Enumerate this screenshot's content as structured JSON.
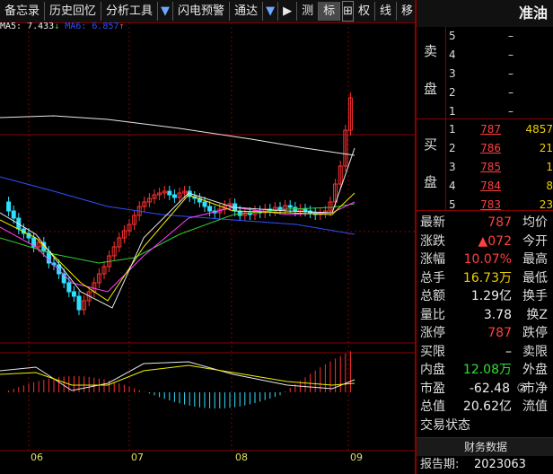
{
  "toolbar": {
    "items": [
      "备忘录",
      "历史回忆",
      "分析工具",
      "闪电预警",
      "通达",
      "测",
      "标",
      "权",
      "线",
      "移"
    ],
    "arrow": "▼",
    "play": "▶"
  },
  "ma": {
    "ma5": "MA5: 7.433",
    "ma5_arrow": "↓",
    "ma6": "MA6: 6.857",
    "ma6_arrow": "↑"
  },
  "stock": {
    "name": "准油"
  },
  "orderbook": {
    "sell_label_1": "卖",
    "sell_label_2": "盘",
    "buy_label_1": "买",
    "buy_label_2": "盘",
    "sell": [
      {
        "level": "5",
        "price": "",
        "vol": "–"
      },
      {
        "level": "4",
        "price": "",
        "vol": "–"
      },
      {
        "level": "3",
        "price": "",
        "vol": "–"
      },
      {
        "level": "2",
        "price": "",
        "vol": "–"
      },
      {
        "level": "1",
        "price": "",
        "vol": "–"
      }
    ],
    "buy": [
      {
        "level": "1",
        "price": "787",
        "vol": "4857"
      },
      {
        "level": "2",
        "price": "786",
        "vol": "21"
      },
      {
        "level": "3",
        "price": "785",
        "vol": "1"
      },
      {
        "level": "4",
        "price": "784",
        "vol": "8"
      },
      {
        "level": "5",
        "price": "783",
        "vol": "23"
      }
    ]
  },
  "stats": [
    {
      "k": "最新",
      "v": "787",
      "vc": "red",
      "k2": "均价"
    },
    {
      "k": "涨跌",
      "v": "▲072",
      "vc": "red",
      "k2": "今开"
    },
    {
      "k": "涨幅",
      "v": "10.07%",
      "vc": "red",
      "k2": "最高"
    },
    {
      "k": "总手",
      "v": "16.73万",
      "vc": "yellow",
      "k2": "最低"
    },
    {
      "k": "总额",
      "v": "1.29亿",
      "vc": "white",
      "k2": "换手"
    },
    {
      "k": "量比",
      "v": "3.78",
      "vc": "white",
      "k2": "换Z"
    },
    {
      "k": "涨停",
      "v": "787",
      "vc": "red",
      "k2": "跌停"
    },
    {
      "k": "买限",
      "v": "–",
      "vc": "white",
      "k2": "卖限"
    },
    {
      "k": "内盘",
      "v": "12.08万",
      "vc": "green",
      "k2": "外盘"
    },
    {
      "k": "市盈",
      "v": "-62.48",
      "vc": "white",
      "k2": "市净"
    },
    {
      "k": "总值",
      "v": "20.62亿",
      "vc": "white",
      "k2": "流值"
    },
    {
      "k": "交易状态",
      "v": "",
      "vc": "white",
      "k2": ""
    }
  ],
  "pe_badge": "②",
  "fin_button": "财务数据",
  "report": {
    "k": "报告期:",
    "v": "2023063"
  },
  "xaxis": [
    "06",
    "07",
    "08",
    "09"
  ],
  "colors": {
    "up": "#ff3030",
    "down": "#30e0ff",
    "ma_white": "#e8e8e8",
    "ma_yellow": "#f0f000",
    "ma_pink": "#ff40ff",
    "ma_green": "#30d030",
    "ma_blue": "#3050ff"
  }
}
